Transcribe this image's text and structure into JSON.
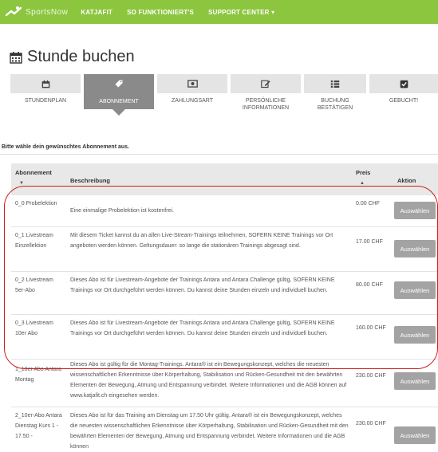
{
  "nav": {
    "logo_text": "SportsNow",
    "links": [
      "KATJAFIT",
      "SO FUNKTIONIERT'S",
      "SUPPORT CENTER ▾"
    ]
  },
  "page": {
    "title": "Stunde buchen"
  },
  "steps": [
    {
      "label": "STUNDENPLAN",
      "icon": "calendar-icon",
      "active": false
    },
    {
      "label": "ABONNEMENT",
      "icon": "tag-icon",
      "active": true
    },
    {
      "label": "ZAHLUNGSART",
      "icon": "money-icon",
      "active": false
    },
    {
      "label": "PERSÖNLICHE INFORMATIONEN",
      "icon": "edit-icon",
      "active": false
    },
    {
      "label": "BUCHUNG BESTÄTIGEN",
      "icon": "list-icon",
      "active": false
    },
    {
      "label": "GEBUCHT!",
      "icon": "check-icon",
      "active": false
    }
  ],
  "instruction": "Bitte wähle dein gewünschtes Abonnement aus.",
  "table": {
    "headers": {
      "abo": "Abonnement",
      "desc": "Beschreibung",
      "price": "Preis",
      "action": "Aktion"
    },
    "rows": [
      {
        "name": "0_0 Probelektion",
        "description": "Eine einmalige Probelektion ist kostenfrei.",
        "price": "0.00 CHF",
        "button": "Auswählen"
      },
      {
        "name": "0_1 Livestream Einzellektion",
        "description": "Mit diesem Ticket kannst du an allen Live-Stream-Trainings teilnehmen, SOFERN KEINE Trainings vor Ort angeboten werden können. Geltungsdauer: so lange die stationären Trainings abgesagt sind.",
        "price": "17.00 CHF",
        "button": "Auswählen"
      },
      {
        "name": "0_2 Livestream 5er-Abo",
        "description": "Dieses Abo ist für Livestream-Angebote der Trainings Antara und Antara Challenge gültig, SOFERN KEINE Trainings vor Ort durchgeführt werden können. Du kannst deine Stunden einzeln und individuell buchen.",
        "price": "80.00 CHF",
        "button": "Auswählen"
      },
      {
        "name": "0_3 Livestream 10er Abo",
        "description": "Dieses Abo ist für Livestream-Angebote der Trainings Antara und Antara Challenge gültig, SOFERN KEINE Trainings vor Ort durchgeführt werden können. Du kannst deine Stunden einzeln und individuell buchen.",
        "price": "160.00 CHF",
        "button": "Auswählen"
      },
      {
        "name": "1_10er Abo Antara Montag",
        "description": "Dieses Abo ist gültig für die Montag-Trainings. Antara® ist ein Bewegungskonzept, welches die neuesten wissenschaftlichen Erkenntnisse über Körperhaltung, Stabilisation und Rücken-Gesundheit mit den bewährten Elementen der Bewegung, Atmung und Entspannung verbindet. Weitere Informationen und die AGB können auf www.katjafit.ch eingesehen werden.",
        "price": "230.00 CHF",
        "button": "Auswählen"
      },
      {
        "name": "2_10er-Abo Antara Dienstag Kurs 1 - 17.50 -",
        "description": "Dieses Abo ist für das Training am Dienstag um 17.50 Uhr gültig. Antara® ist ein Bewegungskonzept, welches die neuesten wissenschaftlichen Erkenntnisse über Körperhaltung, Stabilisation und Rücken-Gesundheit mit den bewährten Elementen der Bewegung, Atmung und Entspannung verbindet. Weitere Informationen und die AGB können",
        "price": "230.00 CHF",
        "button": "Auswählen"
      }
    ]
  },
  "colors": {
    "nav_green": "#8cc63f",
    "active_step": "#8a8a8a",
    "highlight": "#d01c1c",
    "button": "#a3a3a3"
  }
}
